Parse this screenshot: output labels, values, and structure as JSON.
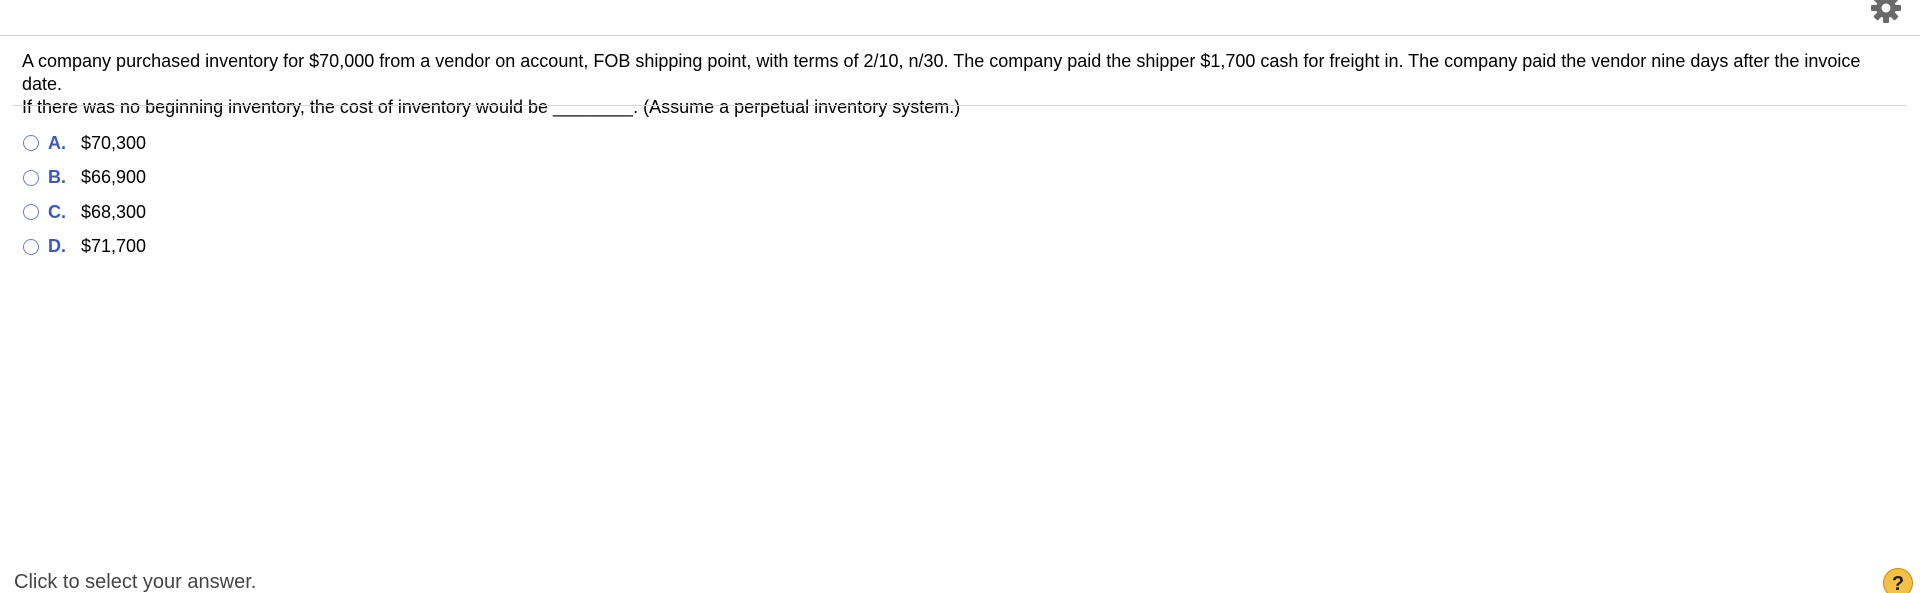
{
  "question": {
    "line1": "A company purchased inventory for $70,000 from a vendor on account, FOB shipping point, with terms of 2/10, n/30. The company paid the shipper $1,700 cash for freight in. The company paid the vendor nine days after the invoice date.",
    "line2": "If there was no beginning inventory, the cost of inventory would be ________. (Assume a perpetual inventory system.)"
  },
  "options": [
    {
      "letter": "A.",
      "value": "$70,300"
    },
    {
      "letter": "B.",
      "value": "$66,900"
    },
    {
      "letter": "C.",
      "value": "$68,300"
    },
    {
      "letter": "D.",
      "value": "$71,700"
    }
  ],
  "footer": {
    "instruction": "Click to select your answer.",
    "help_label": "?"
  },
  "icons": {
    "settings": "gear-icon",
    "help": "help-icon"
  },
  "colors": {
    "accent": "#3b57c4",
    "radio_border": "#6b7fc9",
    "help_bg": "#f4c046",
    "gear": "#6a6a6a"
  }
}
